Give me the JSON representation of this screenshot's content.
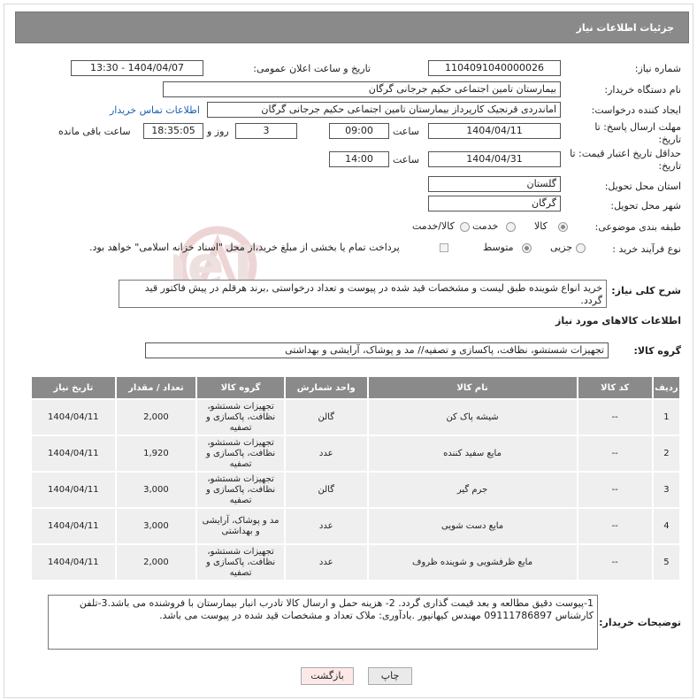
{
  "header": {
    "title": "جزئیات اطلاعات نیاز"
  },
  "fields": {
    "need_number_label": "شماره نیاز:",
    "need_number": "1104091040000026",
    "announce_label": "تاریخ و ساعت اعلان عمومی:",
    "announce_value": "1404/04/07 - 13:30",
    "buyer_org_label": "نام دستگاه خریدار:",
    "buyer_org": "بیمارستان تامین اجتماعی حکیم جرجانی گرگان",
    "creator_label": "ایجاد کننده درخواست:",
    "creator": "اماندردی قرنجیک کارپرداز بیمارستان تامین اجتماعی حکیم جرجانی گرگان",
    "contact_link": "اطلاعات تماس خریدار",
    "deadline_label": "مهلت ارسال پاسخ: تا تاریخ:",
    "deadline_date": "1404/04/11",
    "time_label": "ساعت",
    "deadline_time": "09:00",
    "days_value": "3",
    "days_label": "روز و",
    "remaining_time": "18:35:05",
    "remaining_label": "ساعت باقی مانده",
    "price_valid_label": "حداقل تاریخ اعتبار قیمت: تا تاریخ:",
    "price_valid_date": "1404/04/31",
    "price_valid_time": "14:00",
    "province_label": "استان محل تحویل:",
    "province": "گلستان",
    "city_label": "شهر محل تحویل:",
    "city": "گرگان",
    "category_label": "طبقه بندی موضوعی:",
    "cat_options": [
      "کالا",
      "خدمت",
      "کالا/خدمت"
    ],
    "process_label": "نوع فرآیند خرید :",
    "process_options": [
      "جزیی",
      "متوسط"
    ],
    "payment_note": "پرداخت تمام یا بخشی از مبلغ خرید،از محل \"اسناد خزانه اسلامی\" خواهد بود.",
    "summary_label": "شرح کلی نیاز:",
    "summary": "خرید انواع شوینده طبق لیست و مشخصات قید شده در پیوست و تعداد درخواستی ,برند هرقلم در پیش فاکتور قید گردد.",
    "items_section": "اطلاعات کالاهای مورد نیاز",
    "goods_group_label": "گروه کالا:",
    "goods_group": "تجهیزات شستشو، نظافت، پاکسازی و تصفیه// مد و پوشاک، آرایشی و بهداشتی",
    "buyer_notes_label": "توضیحات خریدار:",
    "buyer_notes": "1-پیوست دقیق مطالعه و بعد قیمت گذاری گردد. 2- هزینه حمل و ارسال کالا تادرب انبار بیمارستان با فروشنده می باشد.3-تلفن کارشناس 09111786897 مهندس کیهانپور .یادآوری: ملاک تعداد و مشخصات قید شده در پیوست می باشد."
  },
  "table": {
    "headers": [
      "ردیف",
      "کد کالا",
      "نام کالا",
      "واحد شمارش",
      "گروه کالا",
      "تعداد / مقدار",
      "تاریخ نیاز"
    ],
    "rows": [
      [
        "1",
        "--",
        "شیشه پاک کن",
        "گالن",
        "تجهیزات شستشو، نظافت، پاکسازی و تصفیه",
        "2,000",
        "1404/04/11"
      ],
      [
        "2",
        "--",
        "مایع سفید کننده",
        "عدد",
        "تجهیزات شستشو، نظافت، پاکسازی و تصفیه",
        "1,920",
        "1404/04/11"
      ],
      [
        "3",
        "--",
        "جرم گیر",
        "گالن",
        "تجهیزات شستشو، نظافت، پاکسازی و تصفیه",
        "3,000",
        "1404/04/11"
      ],
      [
        "4",
        "--",
        "مایع دست شویی",
        "عدد",
        "مد و پوشاک، آرایشی و بهداشتی",
        "3,000",
        "1404/04/11"
      ],
      [
        "5",
        "--",
        "مایع ظرفشویی و شوینده ظروف",
        "عدد",
        "تجهیزات شستشو، نظافت، پاکسازی و تصفیه",
        "2,000",
        "1404/04/11"
      ]
    ]
  },
  "buttons": {
    "print": "چاپ",
    "back": "بازگشت"
  },
  "watermark": "AriaTender.neT",
  "colors": {
    "header_bg": "#8a8a8a",
    "link": "#1a5fb4",
    "watermark": "#e8caca"
  }
}
